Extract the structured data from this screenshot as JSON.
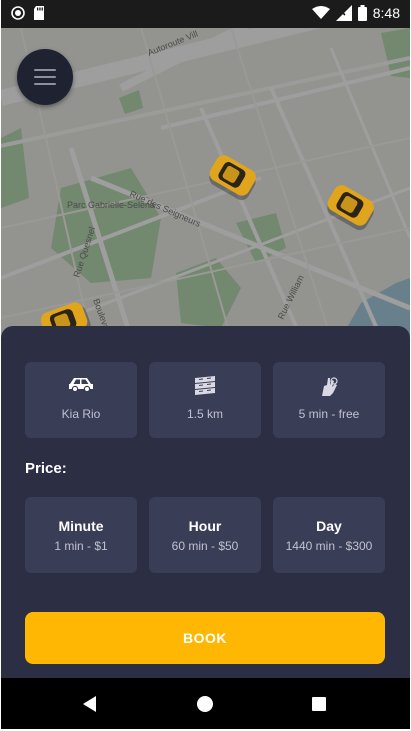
{
  "status_bar": {
    "time": "8:48",
    "left_icons": [
      "record-icon",
      "sd-card-icon"
    ],
    "right_icons": [
      "wifi-icon",
      "signal-icon",
      "battery-icon"
    ]
  },
  "map": {
    "street_labels": [
      "Autoroute Vill",
      "Rue des Seigneurs",
      "Parc Gabrielle-Selena",
      "Rue Quesnel",
      "Boulevard",
      "Rue William",
      "Rue",
      "sal"
    ],
    "car_markers": 3
  },
  "menu": {
    "icon": "hamburger-icon"
  },
  "trip_info": [
    {
      "icon": "car-icon",
      "label": "Kia Rio"
    },
    {
      "icon": "road-icon",
      "label": "1.5 km"
    },
    {
      "icon": "clock-hand-icon",
      "label": "5 min - free"
    }
  ],
  "price": {
    "title": "Price:",
    "options": [
      {
        "name": "Minute",
        "desc": "1 min - $1"
      },
      {
        "name": "Hour",
        "desc": "60 min - $50"
      },
      {
        "name": "Day",
        "desc": "1440 min - $300"
      }
    ]
  },
  "book": {
    "label": "BOOK"
  },
  "nav": {
    "buttons": [
      "back-icon",
      "home-icon",
      "recents-icon"
    ]
  },
  "colors": {
    "accent": "#ffb703",
    "sheet": "#2c2f44",
    "card": "#3a3d56"
  }
}
